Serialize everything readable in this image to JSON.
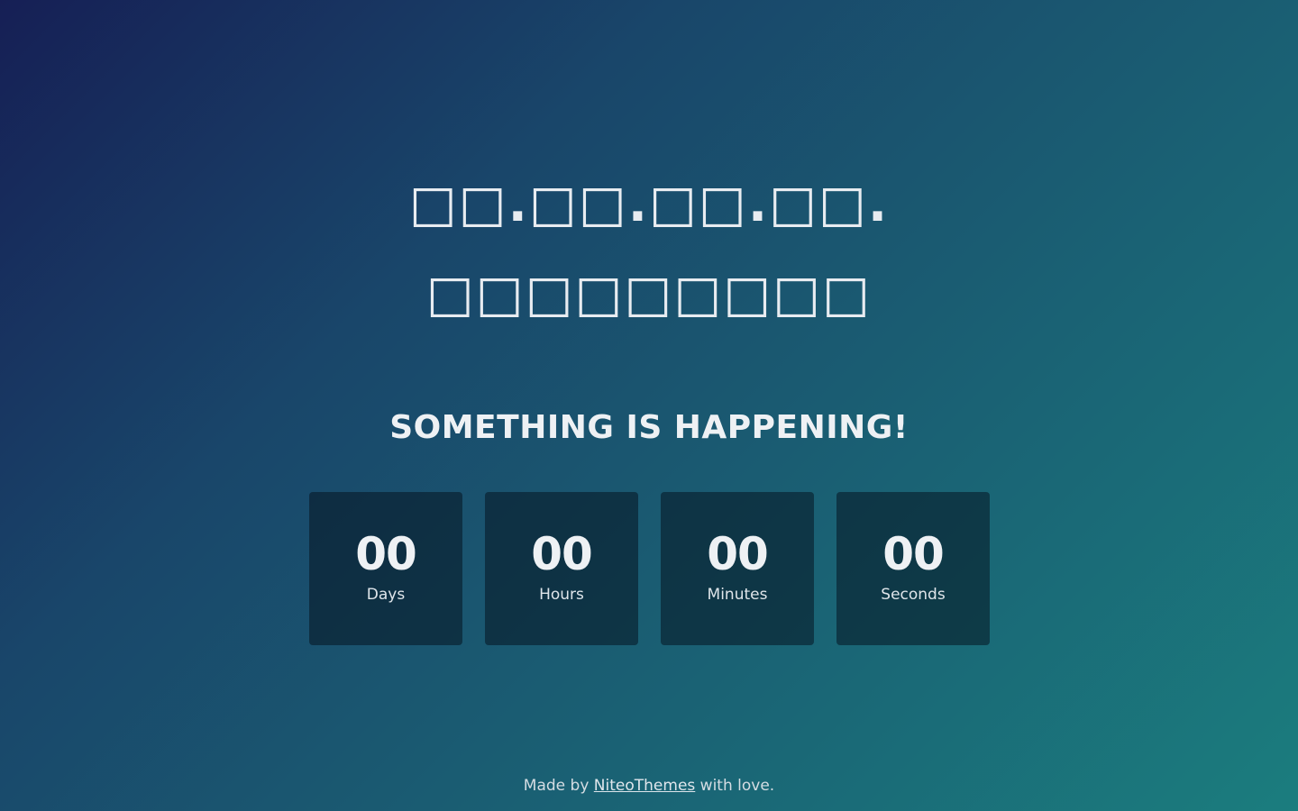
{
  "title": {
    "line1": "□□.□□.□□.□□.",
    "line2": "□□□□□□□□□"
  },
  "subtitle": "SOMETHING IS HAPPENING!",
  "countdown": [
    {
      "value": "00",
      "label": "Days"
    },
    {
      "value": "00",
      "label": "Hours"
    },
    {
      "value": "00",
      "label": "Minutes"
    },
    {
      "value": "00",
      "label": "Seconds"
    }
  ],
  "footer": {
    "prefix": "Made by",
    "link_text": "NiteoThemes",
    "suffix": "with love."
  },
  "colors": {
    "gradient_start": "#161f55",
    "gradient_end": "#1b7d7e",
    "box_background": "#0f2a3a",
    "text": "#eef1f4"
  }
}
